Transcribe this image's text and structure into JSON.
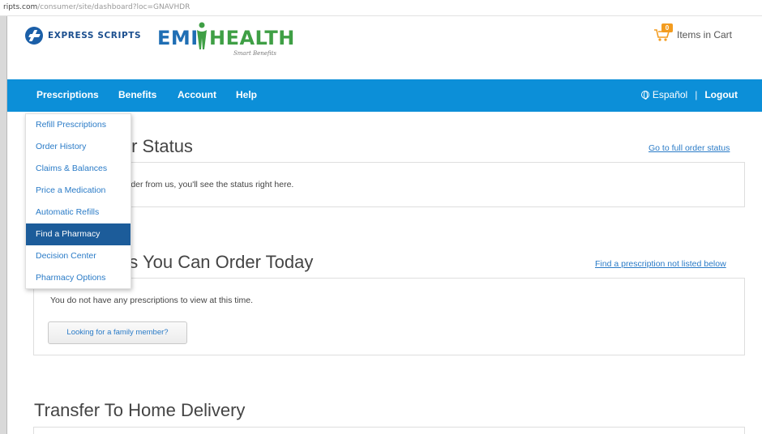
{
  "browser": {
    "url_domain": "ripts.com",
    "url_path": "/consumer/site/dashboard?loc=GNAVHDR"
  },
  "header": {
    "express_scripts_label": "EXPRESS SCRIPTS",
    "emi_label": "EMI",
    "health_label": "HEALTH",
    "emi_tagline": "Smart Benefits",
    "cart_count": "0",
    "cart_label": "Items in Cart"
  },
  "nav": {
    "prescriptions": "Prescriptions",
    "benefits": "Benefits",
    "account": "Account",
    "help": "Help",
    "espanol": "Español",
    "separator": "|",
    "logout": "Logout"
  },
  "dropdown": {
    "items": [
      "Refill Prescriptions",
      "Order History",
      "Claims & Balances",
      "Price a Medication",
      "Automatic Refills",
      "Find a Pharmacy",
      "Decision Center",
      "Pharmacy Options"
    ],
    "active_index": 5
  },
  "order_status": {
    "title": "Order Status",
    "visible_title": "ler Status",
    "link": "Go to full order status",
    "message": "order from us, you'll see the status right here."
  },
  "prescriptions_today": {
    "visible_title": "ns You Can Order Today",
    "link": "Find a prescription not listed below",
    "message": "You do not have any prescriptions to view at this time.",
    "family_button": "Looking for a family member?"
  },
  "transfer": {
    "title": "Transfer To Home Delivery"
  },
  "colors": {
    "nav_blue": "#0c8fd8",
    "menu_active": "#1c5c9a",
    "link_blue": "#2a7bc7",
    "brand_green": "#3f9f45",
    "brand_blue": "#1f6eb4",
    "cart_badge": "#f39c1f"
  }
}
